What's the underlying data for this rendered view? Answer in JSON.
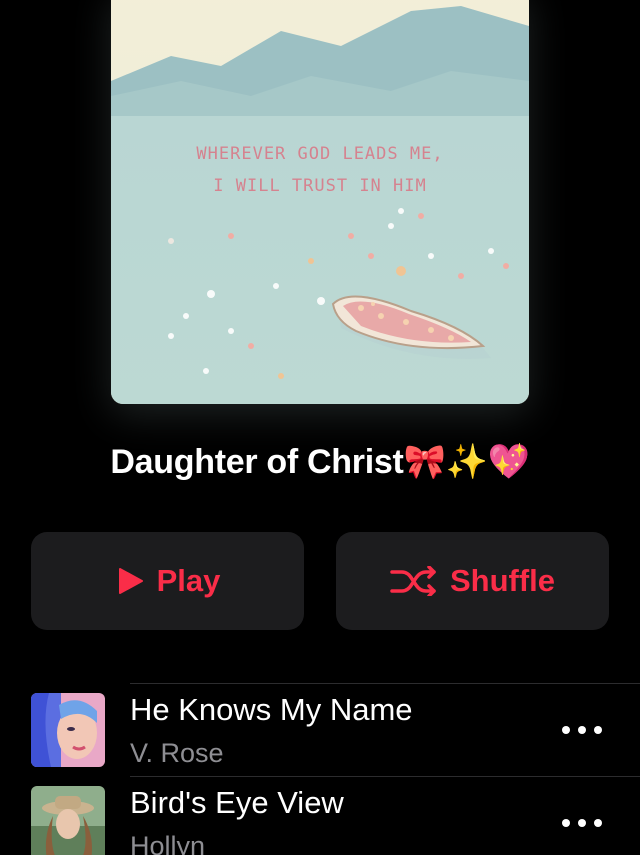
{
  "artwork": {
    "quote_line_1": "WHEREVER GOD LEADS ME,",
    "quote_line_2": "I WILL  TRUST IN HIM"
  },
  "playlist": {
    "title": "Daughter of Christ🎀✨💖"
  },
  "actions": {
    "play_label": "Play",
    "shuffle_label": "Shuffle",
    "play_icon": "play-icon",
    "shuffle_icon": "shuffle-icon"
  },
  "songs": [
    {
      "title": "He Knows My Name",
      "artist": "V. Rose",
      "more_icon": "ellipsis-icon"
    },
    {
      "title": "Bird's Eye View",
      "artist": "Hollyn",
      "more_icon": "ellipsis-icon"
    }
  ],
  "colors": {
    "accent": "#fa2d48",
    "background": "#000000",
    "button_bg": "#1c1c1e",
    "secondary_text": "#8e8e93"
  }
}
